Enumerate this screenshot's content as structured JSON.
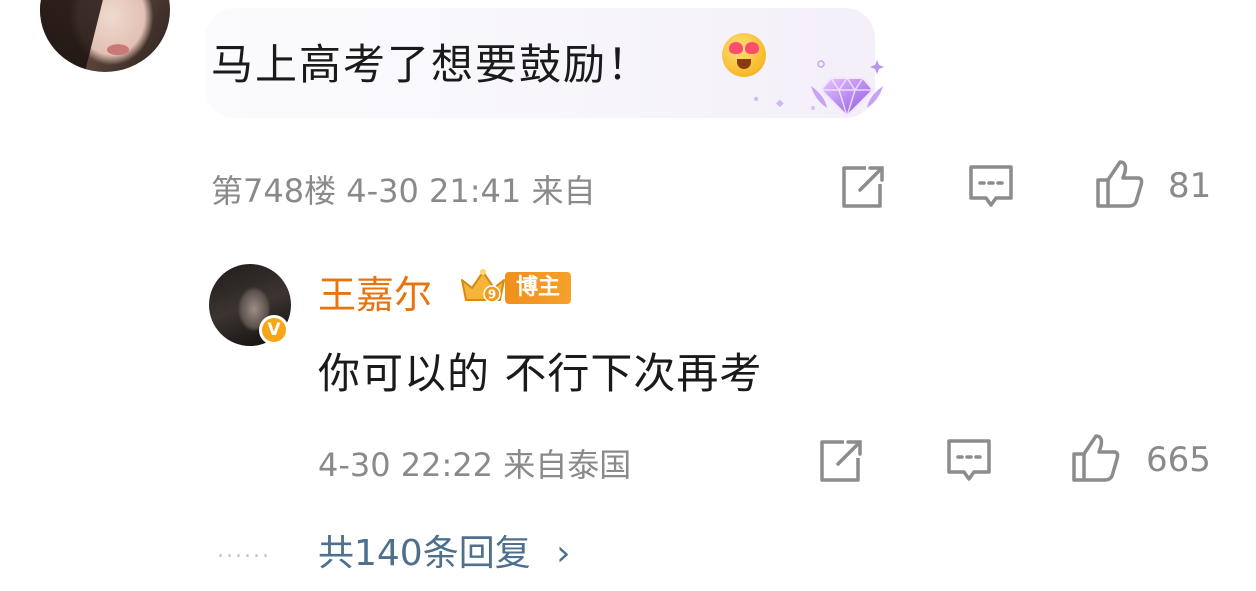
{
  "top_comment": {
    "text": "马上高考了想要鼓励！",
    "emoji_icon": "heart-eyes-emoji",
    "decoration_icon": "purple-gem-badge",
    "meta": "第748楼 4-30 21:41 来自",
    "like_count": "81"
  },
  "reply": {
    "author": "王嘉尔",
    "verified_badge": "V",
    "level_badge": "9",
    "role_badge": "博主",
    "text": "你可以的 不行下次再考",
    "meta": "4-30 22:22 来自泰国",
    "like_count": "665"
  },
  "replies_link": {
    "dots": "......",
    "label": "共140条回复",
    "chevron": "›"
  },
  "colors": {
    "meta_gray": "#8a8a8a",
    "author_orange": "#e8740f",
    "link_blue": "#4f6f8f"
  }
}
